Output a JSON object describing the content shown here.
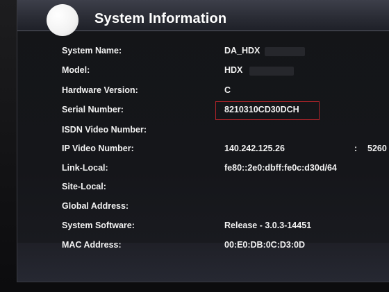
{
  "window": {
    "title": "System Information"
  },
  "fields": [
    {
      "label": "System Name:",
      "value": "DA_HDX"
    },
    {
      "label": "Model:",
      "value": "HDX"
    },
    {
      "label": "Hardware Version:",
      "value": "C"
    },
    {
      "label": "Serial Number:",
      "value": "8210310CD30DCH"
    },
    {
      "label": "ISDN Video Number:",
      "value": ""
    },
    {
      "label": "IP Video Number:",
      "value": "140.242.125.26"
    },
    {
      "label": "Link-Local:",
      "value": "fe80::2e0:dbff:fe0c:d30d/64"
    },
    {
      "label": "Site-Local:",
      "value": ""
    },
    {
      "label": "Global Address:",
      "value": ""
    },
    {
      "label": "System Software:",
      "value": "Release - 3.0.3-14451"
    },
    {
      "label": "MAC Address:",
      "value": "00:E0:DB:0C:D3:0D"
    }
  ],
  "ip_port": {
    "separator": ":",
    "value": "5260"
  },
  "colors": {
    "background": "#151518",
    "text": "#f2f2f2",
    "highlight_border": "#b0242a"
  }
}
